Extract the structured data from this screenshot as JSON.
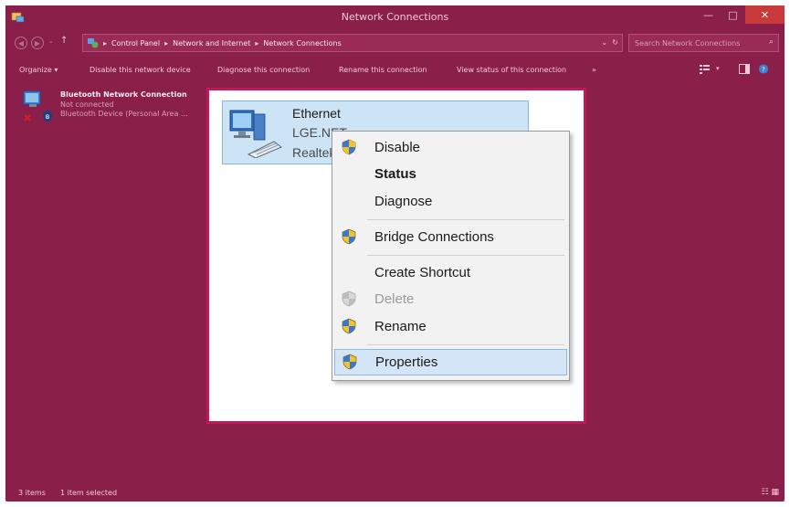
{
  "window": {
    "title": "Network Connections",
    "controls": {
      "minimize": "—",
      "maximize": "□",
      "close": "✕"
    }
  },
  "address": {
    "breadcrumbs": [
      "Control Panel",
      "Network and Internet",
      "Network Connections"
    ],
    "separator": "▸",
    "search_placeholder": "Search Network Connections"
  },
  "toolbar": {
    "items": [
      "Organize ▾",
      "Disable this network device",
      "Diagnose this connection",
      "Rename this connection",
      "View status of this connection",
      "»"
    ]
  },
  "connections": {
    "bluetooth": {
      "name": "Bluetooth Network Connection",
      "status": "Not connected",
      "device": "Bluetooth Device (Personal Area ..."
    },
    "ethernet": {
      "name": "Ethernet",
      "network": "LGE.NET",
      "device": "Realtek"
    }
  },
  "context_menu": {
    "items": [
      {
        "label": "Disable",
        "icon": "shield-icon"
      },
      {
        "label": "Status",
        "bold": true
      },
      {
        "label": "Diagnose"
      },
      {
        "label": "Bridge Connections",
        "icon": "shield-icon"
      },
      {
        "label": "Create Shortcut"
      },
      {
        "label": "Delete",
        "icon": "shield-icon",
        "disabled": true
      },
      {
        "label": "Rename",
        "icon": "shield-icon"
      },
      {
        "label": "Properties",
        "icon": "shield-icon",
        "selected": true
      }
    ]
  },
  "statusbar": {
    "count": "3 items",
    "selected": "1 item selected"
  },
  "colors": {
    "chrome": "#8a1f4a",
    "highlight_border": "#c2185b",
    "selection": "#cde4f7",
    "close_button": "#c93b3b"
  }
}
